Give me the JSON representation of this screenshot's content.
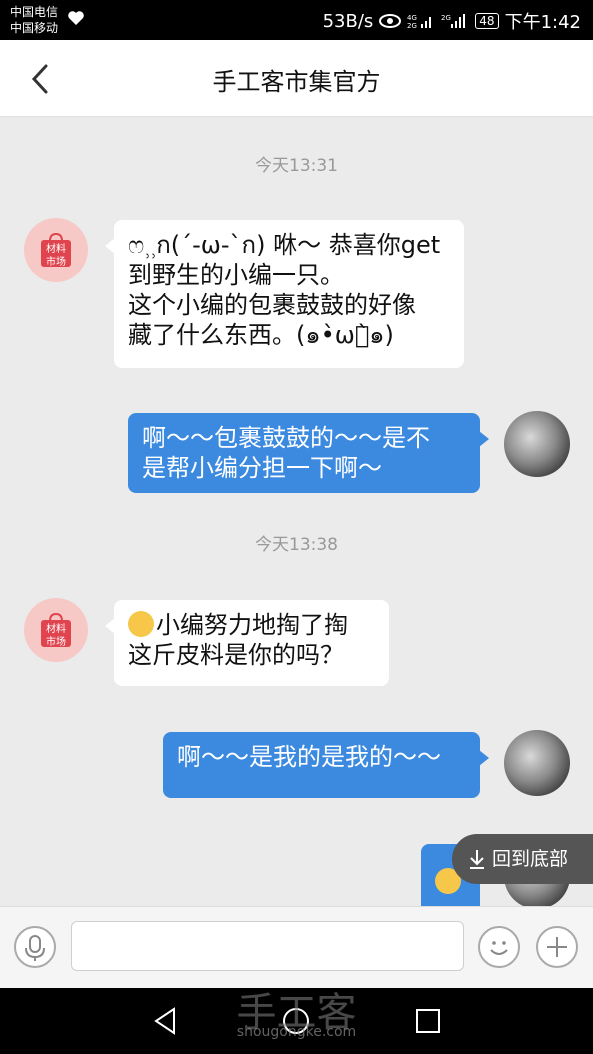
{
  "status": {
    "carrier1": "中国电信",
    "carrier2": "中国移动",
    "net_speed": "53B/s",
    "battery": "48",
    "time": "下午1:42"
  },
  "header": {
    "title": "手工客市集官方"
  },
  "shop_avatar_label": [
    "材料",
    "市场"
  ],
  "messages": [
    {
      "time": "今天13:31"
    },
    {
      "from": "shop",
      "text_line1": "ෆ⸒⸒ก(ˊ-ω-ˋก)  咻～ 恭喜你get",
      "text_line2": "到野生的小编一只。",
      "text_line3": "这个小编的包裹鼓鼓的好像",
      "text_line4": "藏了什么东西。(๑•̀ωก̀๑)"
    },
    {
      "from": "me",
      "text_line1": "啊～～包裹鼓鼓的～～是不",
      "text_line2": "是帮小编分担一下啊～"
    },
    {
      "time": "今天13:38"
    },
    {
      "from": "shop",
      "text_line1": "小编努力地掏了掏",
      "text_line2": "这斤皮料是你的吗？"
    },
    {
      "from": "me",
      "text_line1": "啊～～是我的是我的～～"
    }
  ],
  "back_to_bottom": "回到底部",
  "input": {
    "placeholder": ""
  },
  "watermark": {
    "main": "手工客",
    "sub": "shougongke.com"
  }
}
